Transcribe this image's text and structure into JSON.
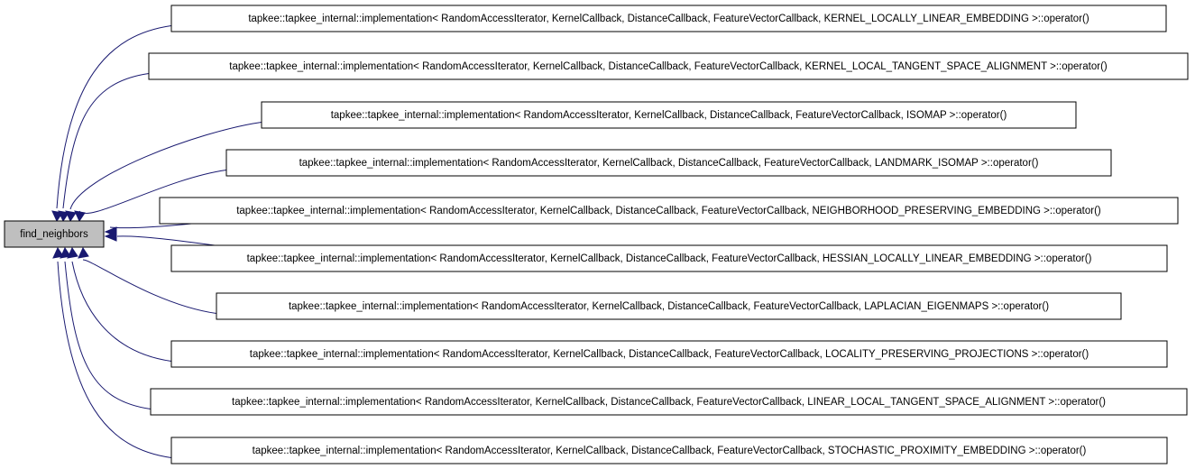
{
  "root": {
    "label": "find_neighbors"
  },
  "callers": [
    "tapkee::tapkee_internal::implementation< RandomAccessIterator, KernelCallback, DistanceCallback, FeatureVectorCallback, KERNEL_LOCALLY_LINEAR_EMBEDDING >::operator()",
    "tapkee::tapkee_internal::implementation< RandomAccessIterator, KernelCallback, DistanceCallback, FeatureVectorCallback, KERNEL_LOCAL_TANGENT_SPACE_ALIGNMENT >::operator()",
    "tapkee::tapkee_internal::implementation< RandomAccessIterator, KernelCallback, DistanceCallback, FeatureVectorCallback, ISOMAP >::operator()",
    "tapkee::tapkee_internal::implementation< RandomAccessIterator, KernelCallback, DistanceCallback, FeatureVectorCallback, LANDMARK_ISOMAP >::operator()",
    "tapkee::tapkee_internal::implementation< RandomAccessIterator, KernelCallback, DistanceCallback, FeatureVectorCallback, NEIGHBORHOOD_PRESERVING_EMBEDDING >::operator()",
    "tapkee::tapkee_internal::implementation< RandomAccessIterator, KernelCallback, DistanceCallback, FeatureVectorCallback, HESSIAN_LOCALLY_LINEAR_EMBEDDING >::operator()",
    "tapkee::tapkee_internal::implementation< RandomAccessIterator, KernelCallback, DistanceCallback, FeatureVectorCallback, LAPLACIAN_EIGENMAPS >::operator()",
    "tapkee::tapkee_internal::implementation< RandomAccessIterator, KernelCallback, DistanceCallback, FeatureVectorCallback, LOCALITY_PRESERVING_PROJECTIONS >::operator()",
    "tapkee::tapkee_internal::implementation< RandomAccessIterator, KernelCallback, DistanceCallback, FeatureVectorCallback, LINEAR_LOCAL_TANGENT_SPACE_ALIGNMENT >::operator()",
    "tapkee::tapkee_internal::implementation< RandomAccessIterator, KernelCallback, DistanceCallback, FeatureVectorCallback, STOCHASTIC_PROXIMITY_EMBEDDING >::operator()"
  ],
  "colors": {
    "edge": "#191970",
    "root_fill": "#bfbfbf",
    "node_fill": "#ffffff",
    "border": "#000000"
  }
}
